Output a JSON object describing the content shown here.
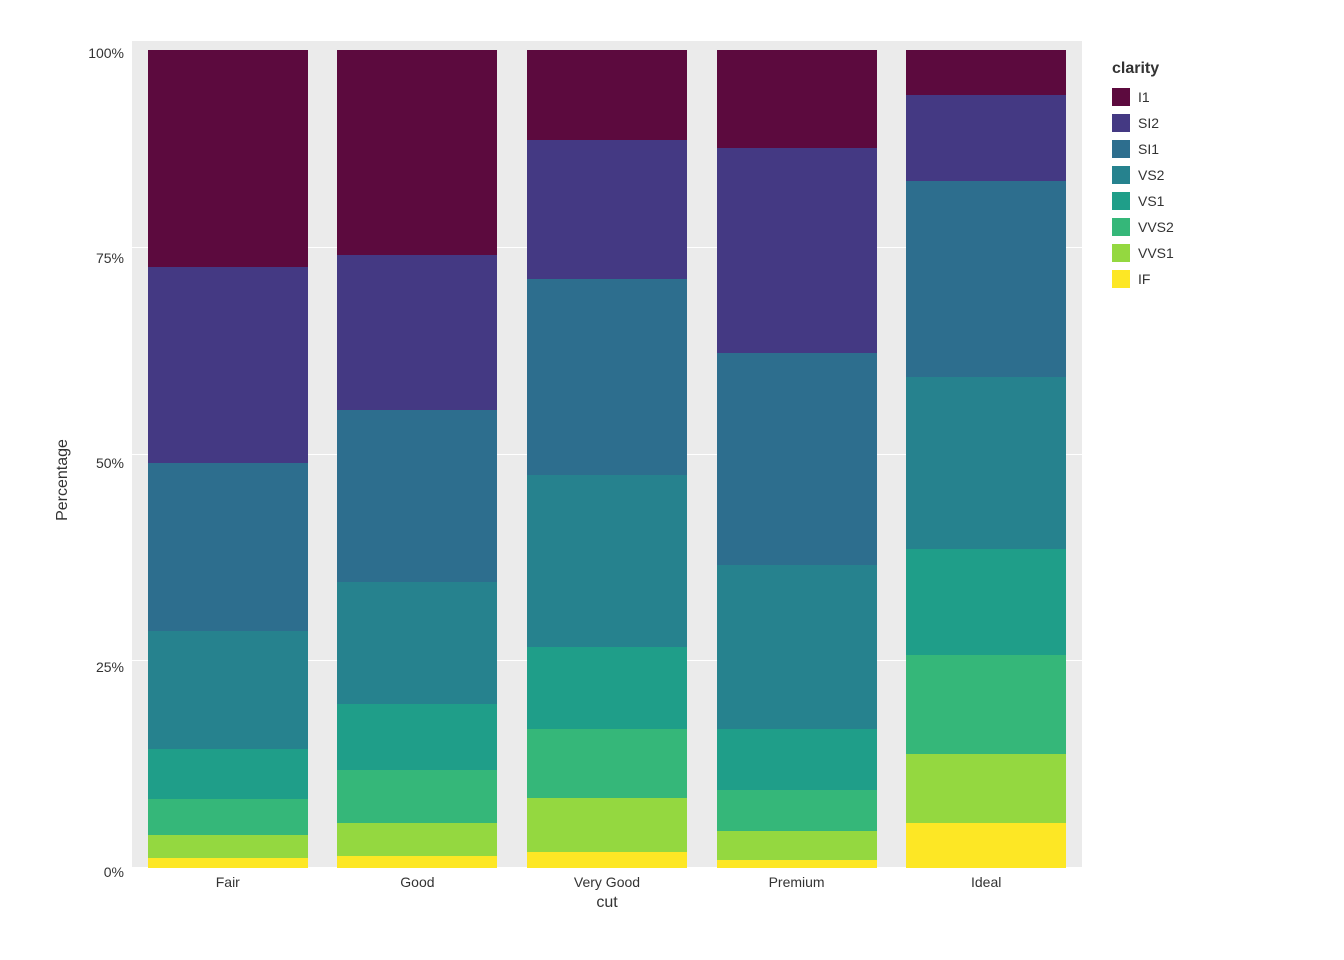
{
  "chart": {
    "title": "",
    "y_axis_label": "Percentage",
    "x_axis_label": "cut",
    "y_ticks": [
      "100%",
      "75%",
      "50%",
      "25%",
      "0%"
    ],
    "x_ticks": [
      "Fair",
      "Good",
      "Very Good",
      "Premium",
      "Ideal"
    ],
    "legend_title": "clarity",
    "legend_items": [
      {
        "label": "I1",
        "color": "#5c0a3e"
      },
      {
        "label": "SI2",
        "color": "#443983"
      },
      {
        "label": "SI1",
        "color": "#2d6e8e"
      },
      {
        "label": "VS2",
        "color": "#26828e"
      },
      {
        "label": "VS1",
        "color": "#1f9e89"
      },
      {
        "label": "VVS2",
        "color": "#35b779"
      },
      {
        "label": "VVS1",
        "color": "#94d840"
      },
      {
        "label": "IF",
        "color": "#fde725"
      }
    ],
    "bars": [
      {
        "cut": "Fair",
        "segments": [
          {
            "clarity": "IF",
            "pct": 1.2,
            "color": "#fde725"
          },
          {
            "clarity": "VVS1",
            "pct": 2.8,
            "color": "#94d840"
          },
          {
            "clarity": "VVS2",
            "pct": 4.5,
            "color": "#35b779"
          },
          {
            "clarity": "VS1",
            "pct": 6.0,
            "color": "#1f9e89"
          },
          {
            "clarity": "VS2",
            "pct": 14.5,
            "color": "#26828e"
          },
          {
            "clarity": "SI1",
            "pct": 20.5,
            "color": "#2d6e8e"
          },
          {
            "clarity": "SI2",
            "pct": 24.0,
            "color": "#443983"
          },
          {
            "clarity": "I1",
            "pct": 26.5,
            "color": "#5c0a3e"
          }
        ]
      },
      {
        "cut": "Good",
        "segments": [
          {
            "clarity": "IF",
            "pct": 1.5,
            "color": "#fde725"
          },
          {
            "clarity": "VVS1",
            "pct": 4.0,
            "color": "#94d840"
          },
          {
            "clarity": "VVS2",
            "pct": 6.5,
            "color": "#35b779"
          },
          {
            "clarity": "VS1",
            "pct": 8.0,
            "color": "#1f9e89"
          },
          {
            "clarity": "VS2",
            "pct": 15.0,
            "color": "#26828e"
          },
          {
            "clarity": "SI1",
            "pct": 21.0,
            "color": "#2d6e8e"
          },
          {
            "clarity": "SI2",
            "pct": 19.0,
            "color": "#443983"
          },
          {
            "clarity": "I1",
            "pct": 25.0,
            "color": "#5c0a3e"
          }
        ]
      },
      {
        "cut": "Very Good",
        "segments": [
          {
            "clarity": "IF",
            "pct": 2.0,
            "color": "#fde725"
          },
          {
            "clarity": "VVS1",
            "pct": 6.5,
            "color": "#94d840"
          },
          {
            "clarity": "VVS2",
            "pct": 8.5,
            "color": "#35b779"
          },
          {
            "clarity": "VS1",
            "pct": 10.0,
            "color": "#1f9e89"
          },
          {
            "clarity": "VS2",
            "pct": 21.0,
            "color": "#26828e"
          },
          {
            "clarity": "SI1",
            "pct": 24.0,
            "color": "#2d6e8e"
          },
          {
            "clarity": "SI2",
            "pct": 17.0,
            "color": "#443983"
          },
          {
            "clarity": "I1",
            "pct": 11.0,
            "color": "#5c0a3e"
          }
        ]
      },
      {
        "cut": "Premium",
        "segments": [
          {
            "clarity": "IF",
            "pct": 1.0,
            "color": "#fde725"
          },
          {
            "clarity": "VVS1",
            "pct": 3.5,
            "color": "#94d840"
          },
          {
            "clarity": "VVS2",
            "pct": 5.0,
            "color": "#35b779"
          },
          {
            "clarity": "VS1",
            "pct": 7.5,
            "color": "#1f9e89"
          },
          {
            "clarity": "VS2",
            "pct": 20.0,
            "color": "#26828e"
          },
          {
            "clarity": "SI1",
            "pct": 26.0,
            "color": "#2d6e8e"
          },
          {
            "clarity": "SI2",
            "pct": 25.0,
            "color": "#443983"
          },
          {
            "clarity": "I1",
            "pct": 12.0,
            "color": "#5c0a3e"
          }
        ]
      },
      {
        "cut": "Ideal",
        "segments": [
          {
            "clarity": "IF",
            "pct": 5.5,
            "color": "#fde725"
          },
          {
            "clarity": "VVS1",
            "pct": 8.5,
            "color": "#94d840"
          },
          {
            "clarity": "VVS2",
            "pct": 12.0,
            "color": "#35b779"
          },
          {
            "clarity": "VS1",
            "pct": 13.0,
            "color": "#1f9e89"
          },
          {
            "clarity": "VS2",
            "pct": 21.0,
            "color": "#26828e"
          },
          {
            "clarity": "SI1",
            "pct": 24.0,
            "color": "#2d6e8e"
          },
          {
            "clarity": "SI2",
            "pct": 10.5,
            "color": "#443983"
          },
          {
            "clarity": "I1",
            "pct": 5.5,
            "color": "#5c0a3e"
          }
        ]
      }
    ]
  }
}
